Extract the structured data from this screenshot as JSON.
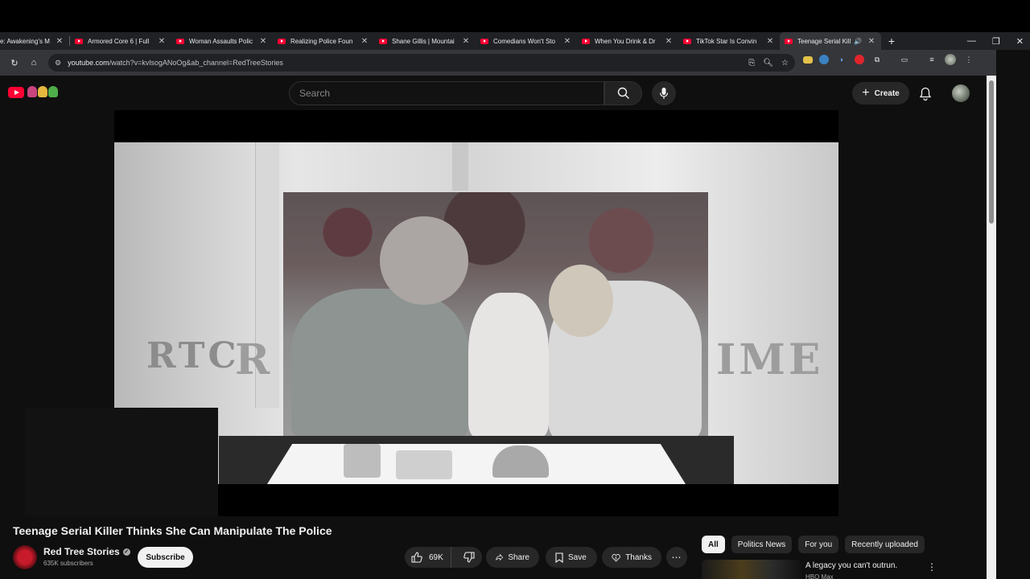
{
  "tabs": [
    {
      "title": "e: Awakening's M"
    },
    {
      "title": "Armored Core 6 | Full"
    },
    {
      "title": "Woman Assaults Polic"
    },
    {
      "title": "Realizing Police Foun"
    },
    {
      "title": "Shane Gillis | Mountai"
    },
    {
      "title": "Comedians Won't Sto"
    },
    {
      "title": "When You Drink & Dr"
    },
    {
      "title": "TikTok Star Is Convin"
    },
    {
      "title": "Teenage Serial Kill",
      "active": true
    }
  ],
  "address_bar": {
    "domain": "youtube.com",
    "path": "/watch?v=kvlsogANoOg&ab_channel=RedTreeStories"
  },
  "masthead": {
    "search_placeholder": "Search",
    "create_label": "Create"
  },
  "player": {
    "watermark_left": "RTC",
    "watermark_r": "R",
    "watermark_right": "IME"
  },
  "video": {
    "title": "Teenage Serial Killer Thinks She Can Manipulate The Police",
    "channel": "Red Tree Stories",
    "subscribers": "635K subscribers",
    "subscribe_label": "Subscribe",
    "likes": "69K",
    "share_label": "Share",
    "save_label": "Save",
    "thanks_label": "Thanks"
  },
  "chips": [
    "All",
    "Politics News",
    "For you",
    "Recently uploaded"
  ],
  "recommendation": {
    "title": "A legacy you can't outrun.",
    "channel": "HBO Max"
  },
  "colors": {
    "brand_red": "#ff0033",
    "background": "#0f0f0f",
    "chrome_dark": "#202124"
  }
}
